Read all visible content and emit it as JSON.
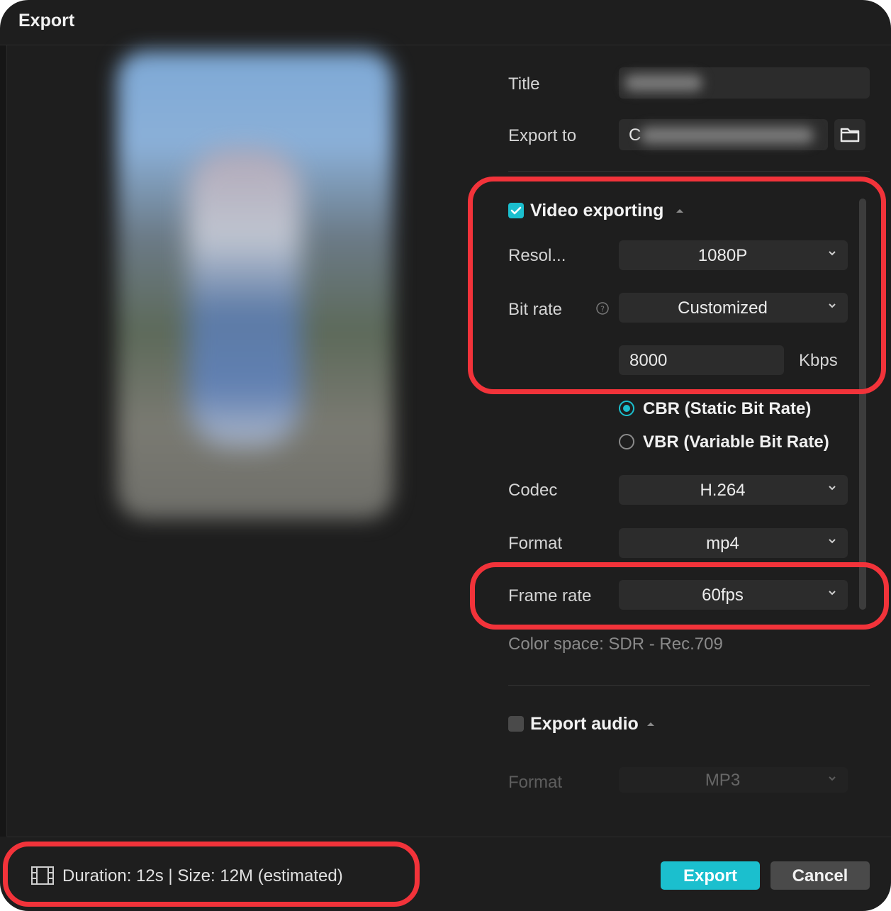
{
  "window": {
    "title": "Export"
  },
  "fields": {
    "title_label": "Title",
    "export_to_label": "Export to",
    "export_to_prefix": "C"
  },
  "video": {
    "section_label": "Video exporting",
    "checked": true,
    "resolution_label": "Resol...",
    "resolution_value": "1080P",
    "bitrate_label": "Bit rate",
    "bitrate_value": "Customized",
    "bitrate_number": "8000",
    "bitrate_unit": "Kbps",
    "cbr_label": "CBR (Static Bit Rate)",
    "vbr_label": "VBR (Variable Bit Rate)",
    "codec_label": "Codec",
    "codec_value": "H.264",
    "format_label": "Format",
    "format_value": "mp4",
    "framerate_label": "Frame rate",
    "framerate_value": "60fps",
    "color_space": "Color space: SDR - Rec.709"
  },
  "audio": {
    "section_label": "Export audio",
    "checked": false,
    "format_label": "Format",
    "format_value": "MP3"
  },
  "footer": {
    "info": "Duration: 12s | Size: 12M (estimated)",
    "export_label": "Export",
    "cancel_label": "Cancel"
  },
  "colors": {
    "accent": "#1bbfce",
    "highlight": "#f2333a",
    "background": "#1e1e1e",
    "field": "#2c2c2c"
  },
  "icons": [
    "folder-icon",
    "help-icon",
    "chevron-down-icon",
    "caret-up-icon",
    "film-icon"
  ]
}
